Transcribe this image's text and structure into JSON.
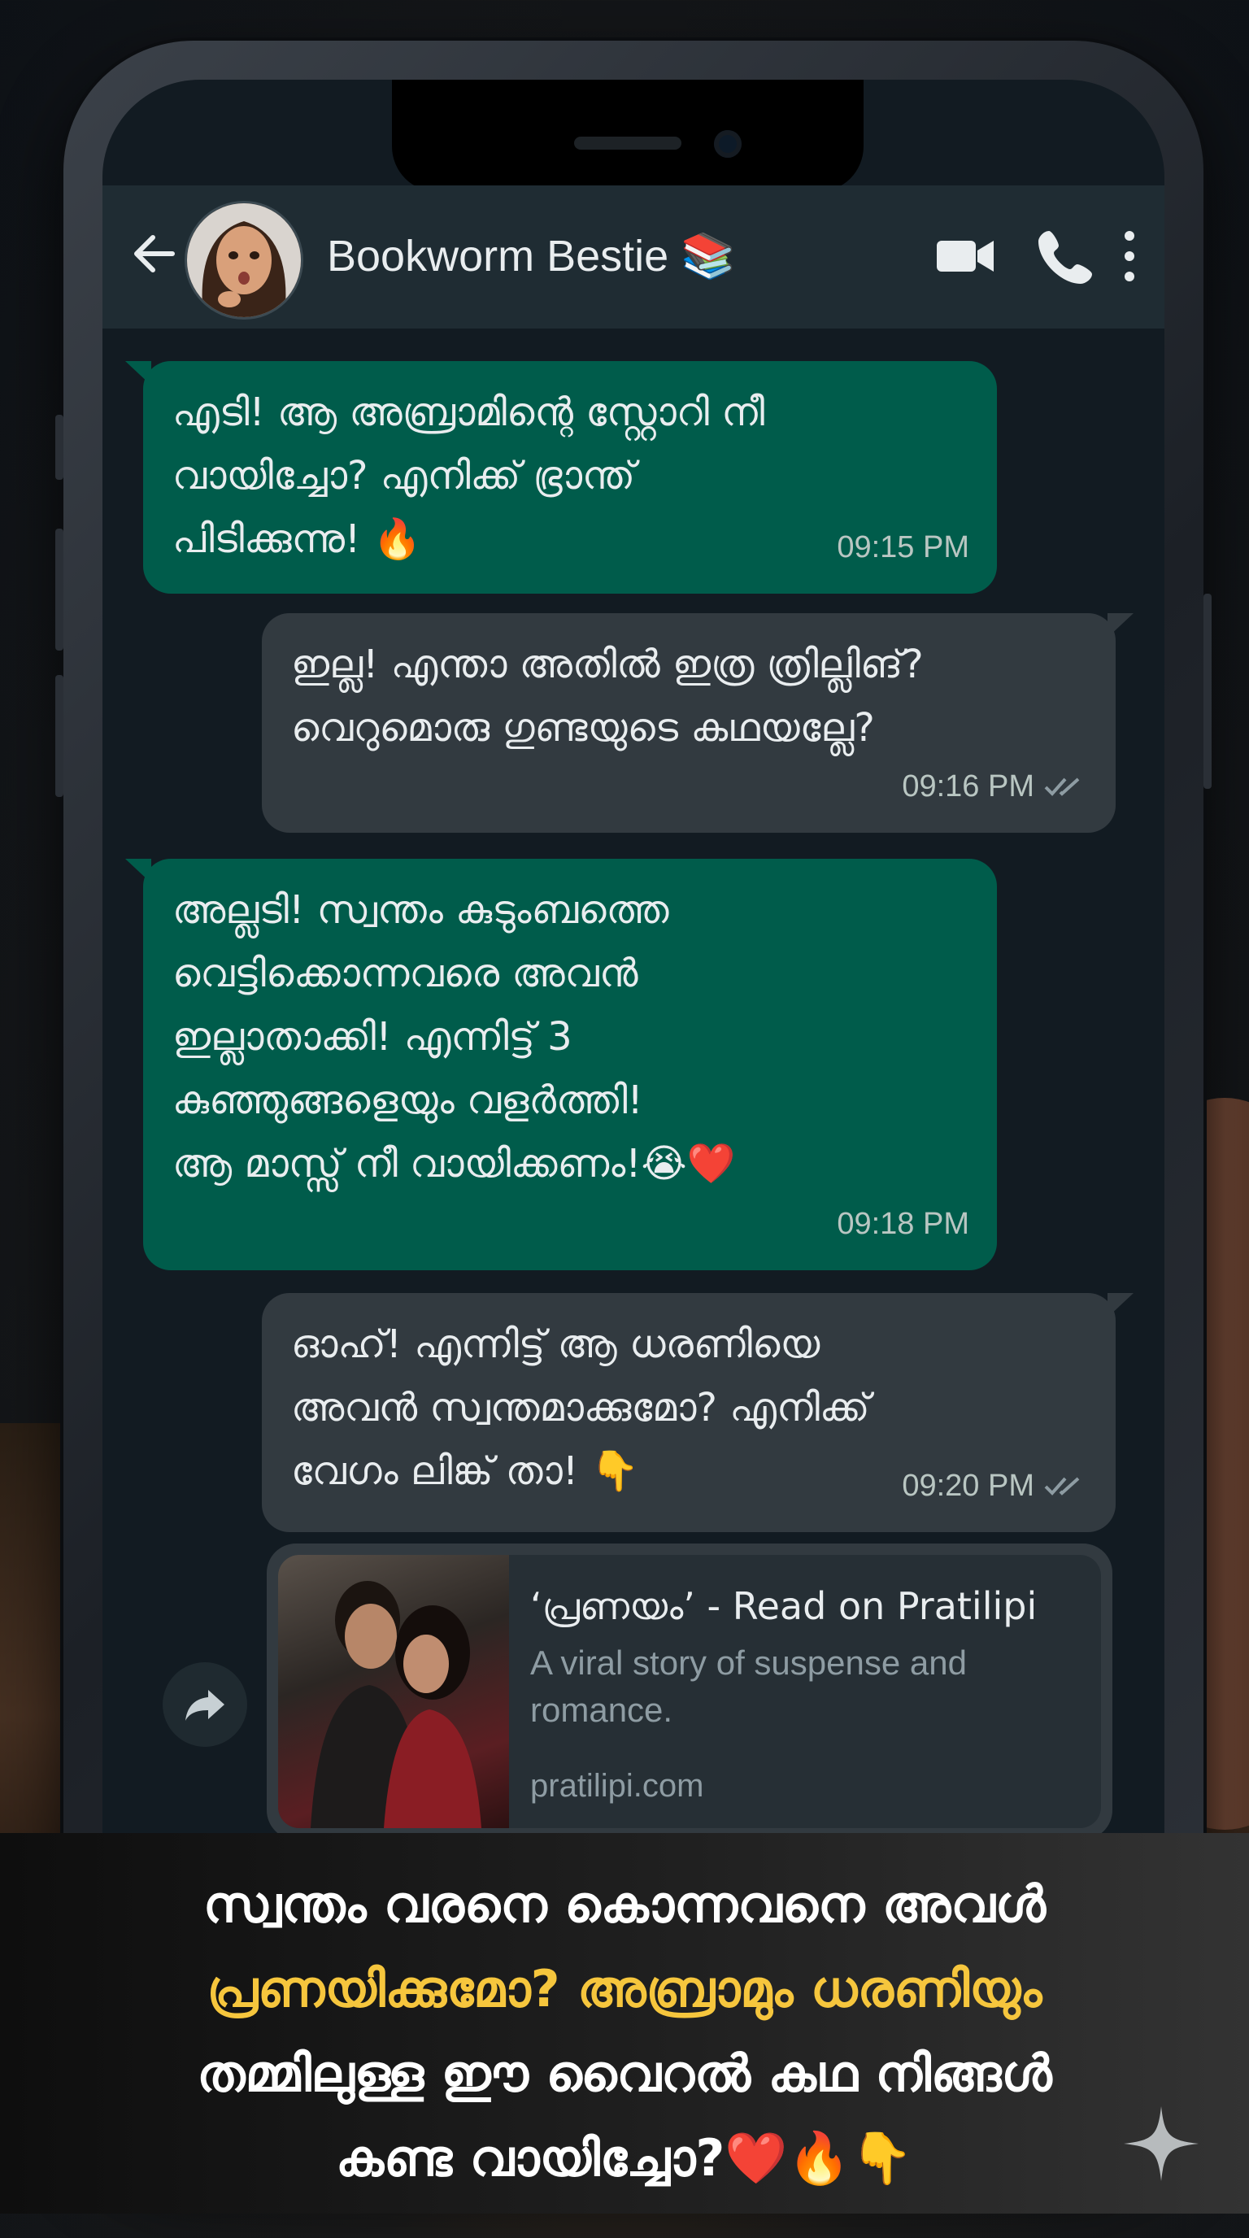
{
  "header": {
    "contact_name": "Bookworm Bestie 📚"
  },
  "messages": [
    {
      "direction": "in",
      "lines": [
        "എടി! ആ അബ്രാമിന്റെ സ്റ്റോറി നീ",
        "വായിച്ചോ? എനിക്ക് ഭ്രാന്ത്",
        "പിടിക്കുന്നു! 🔥"
      ],
      "time": "09:15 PM"
    },
    {
      "direction": "out",
      "lines": [
        "ഇല്ല! എന്താ അതിൽ ഇത്ര ത്രില്ലിങ്?",
        "വെറുമൊരു ഗുണ്ടയുടെ കഥയല്ലേ?"
      ],
      "time": "09:16 PM"
    },
    {
      "direction": "in",
      "lines": [
        "അല്ലടി! സ്വന്തം കുടുംബത്തെ",
        "വെട്ടിക്കൊന്നവരെ അവൻ",
        "ഇല്ലാതാക്കി! എന്നിട്ട് 3",
        "കുഞ്ഞുങ്ങളെയും വളർത്തി!",
        "ആ മാസ്സ് നീ വായിക്കണം!😭❤️"
      ],
      "time": "09:18 PM"
    },
    {
      "direction": "out",
      "lines": [
        "ഓഹ്! എന്നിട്ട് ആ ധരണിയെ",
        "അവൻ സ്വന്തമാക്കുമോ? എനിക്ക്",
        "വേഗം ലിങ്ക് താ! 👇"
      ],
      "time": "09:20 PM"
    }
  ],
  "link_preview": {
    "title": "‘പ്രണയം’ - Read on Pratilipi",
    "description": "A viral story of suspense and romance.",
    "domain": "pratilipi.com"
  },
  "caption": {
    "line1": "സ്വന്തം വരനെ കൊന്നവനെ അവൾ",
    "line2": "പ്രണയിക്കുമോ? അബ്രാമും ധരണിയും",
    "line3": "തമ്മിലുള്ള ഈ വൈറൽ കഥ നിങ്ങൾ",
    "line4": "കണ്ട വായിച്ചോ?❤️🔥👇"
  },
  "colors": {
    "incoming_bubble": "#005c4b",
    "outgoing_bubble": "#323a40",
    "header_bg": "#1f2c33",
    "chat_bg": "#121b22",
    "highlight": "#f6c63d"
  },
  "icons": [
    "back-arrow-icon",
    "video-call-icon",
    "phone-icon",
    "more-vert-icon",
    "double-check-icon",
    "forward-icon",
    "sparkle-icon"
  ]
}
